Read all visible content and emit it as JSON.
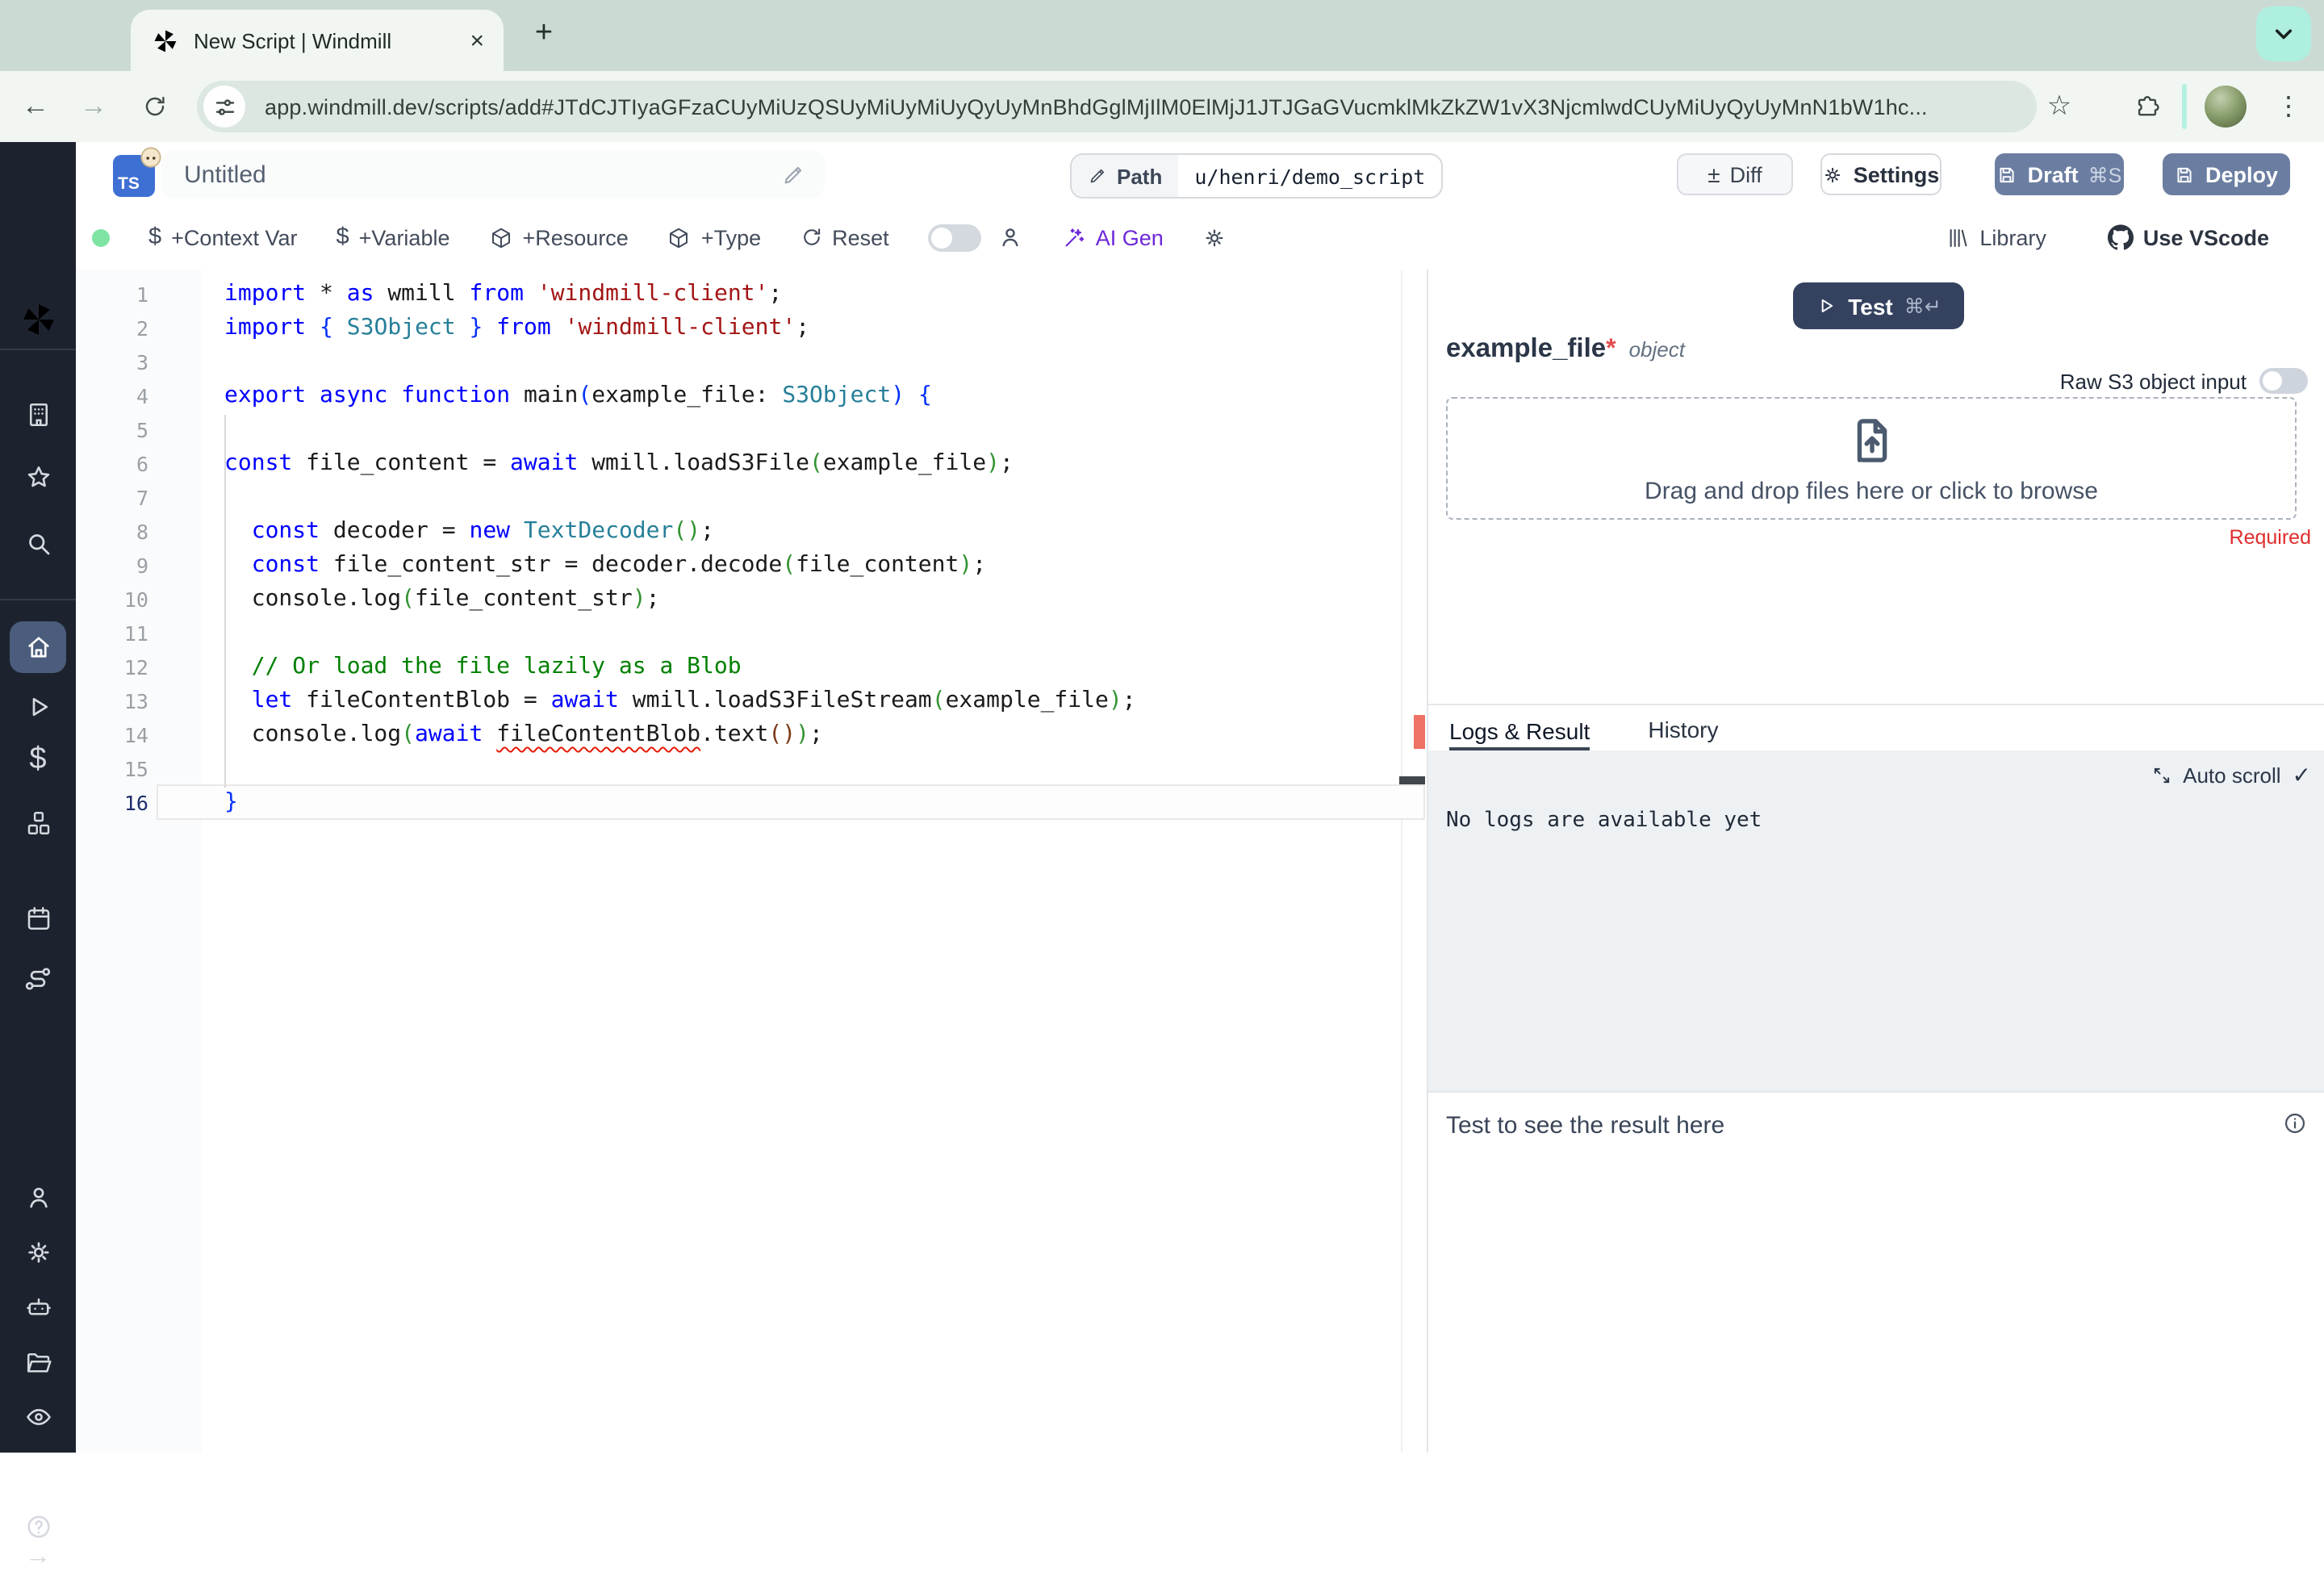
{
  "browser": {
    "tab_title": "New Script | Windmill",
    "url": "app.windmill.dev/scripts/add#JTdCJTIyaGFzaCUyMiUzQSUyMiUyMiUyQyUyMnBhdGglMjIlM0ElMjJ1JTJGaGVucmklMkZkZW1vX3NjcmlwdCUyMiUyQyUyMnN1bW1hc...",
    "glyphs": {
      "close": "×",
      "new_tab": "+",
      "back": "←",
      "forward": "→",
      "star": "☆",
      "menu": "⋮"
    }
  },
  "header": {
    "lang_badge": "TS",
    "title": "Untitled",
    "path_label": "Path",
    "path_value": "u/henri/demo_script",
    "diff_glyph": "±",
    "diff_label": "Diff",
    "settings_label": "Settings",
    "draft_label": "Draft",
    "draft_shortcut": "⌘S",
    "deploy_label": "Deploy"
  },
  "toolbar": {
    "dollar_glyph": "$",
    "context_var": "+Context Var",
    "variable": "+Variable",
    "resource": "+Resource",
    "type": "+Type",
    "reset": "Reset",
    "ai_gen": "AI Gen",
    "library": "Library",
    "vscode": "Use VScode"
  },
  "editor": {
    "active_line": 16,
    "lines": [
      {
        "n": 1,
        "t": [
          [
            "k",
            "import"
          ],
          [
            "p",
            " * "
          ],
          [
            "k",
            "as"
          ],
          [
            "p",
            " wmill "
          ],
          [
            "k",
            "from"
          ],
          [
            "p",
            " "
          ],
          [
            "s",
            "'windmill-client'"
          ],
          [
            "p",
            ";"
          ]
        ]
      },
      {
        "n": 2,
        "t": [
          [
            "k",
            "import"
          ],
          [
            "p",
            " "
          ],
          [
            "b1",
            "{"
          ],
          [
            "p",
            " "
          ],
          [
            "t",
            "S3Object"
          ],
          [
            "p",
            " "
          ],
          [
            "b1",
            "}"
          ],
          [
            "p",
            " "
          ],
          [
            "k",
            "from"
          ],
          [
            "p",
            " "
          ],
          [
            "s",
            "'windmill-client'"
          ],
          [
            "p",
            ";"
          ]
        ]
      },
      {
        "n": 3,
        "t": []
      },
      {
        "n": 4,
        "t": [
          [
            "k",
            "export"
          ],
          [
            "p",
            " "
          ],
          [
            "k",
            "async"
          ],
          [
            "p",
            " "
          ],
          [
            "k",
            "function"
          ],
          [
            "p",
            " main"
          ],
          [
            "b1",
            "("
          ],
          [
            "p",
            "example_file: "
          ],
          [
            "t",
            "S3Object"
          ],
          [
            "b1",
            ")"
          ],
          [
            "p",
            " "
          ],
          [
            "b1",
            "{"
          ]
        ]
      },
      {
        "n": 5,
        "t": []
      },
      {
        "n": 6,
        "t": [
          [
            "k",
            "const"
          ],
          [
            "p",
            " file_content = "
          ],
          [
            "k",
            "await"
          ],
          [
            "p",
            " wmill.loadS3File"
          ],
          [
            "b2",
            "("
          ],
          [
            "p",
            "example_file"
          ],
          [
            "b2",
            ")"
          ],
          [
            "p",
            ";"
          ]
        ]
      },
      {
        "n": 7,
        "t": []
      },
      {
        "n": 8,
        "t": [
          [
            "p",
            "  "
          ],
          [
            "k",
            "const"
          ],
          [
            "p",
            " decoder = "
          ],
          [
            "k",
            "new"
          ],
          [
            "p",
            " "
          ],
          [
            "t",
            "TextDecoder"
          ],
          [
            "b2",
            "()"
          ],
          [
            "p",
            ";"
          ]
        ]
      },
      {
        "n": 9,
        "t": [
          [
            "p",
            "  "
          ],
          [
            "k",
            "const"
          ],
          [
            "p",
            " file_content_str = decoder.decode"
          ],
          [
            "b2",
            "("
          ],
          [
            "p",
            "file_content"
          ],
          [
            "b2",
            ")"
          ],
          [
            "p",
            ";"
          ]
        ]
      },
      {
        "n": 10,
        "t": [
          [
            "p",
            "  console.log"
          ],
          [
            "b2",
            "("
          ],
          [
            "p",
            "file_content_str"
          ],
          [
            "b2",
            ")"
          ],
          [
            "p",
            ";"
          ]
        ]
      },
      {
        "n": 11,
        "t": []
      },
      {
        "n": 12,
        "t": [
          [
            "c",
            "  // Or load the file lazily as a Blob"
          ]
        ]
      },
      {
        "n": 13,
        "t": [
          [
            "p",
            "  "
          ],
          [
            "k",
            "let"
          ],
          [
            "p",
            " fileContentBlob = "
          ],
          [
            "k",
            "await"
          ],
          [
            "p",
            " wmill.loadS3FileStream"
          ],
          [
            "b2",
            "("
          ],
          [
            "p",
            "example_file"
          ],
          [
            "b2",
            ")"
          ],
          [
            "p",
            ";"
          ]
        ]
      },
      {
        "n": 14,
        "t": [
          [
            "p",
            "  console.log"
          ],
          [
            "b2",
            "("
          ],
          [
            "k",
            "await"
          ],
          [
            "p",
            " "
          ],
          [
            "e",
            "fileContentBlob"
          ],
          [
            "p",
            ".text"
          ],
          [
            "b3",
            "()"
          ],
          [
            "b2",
            ")"
          ],
          [
            "p",
            ";"
          ]
        ]
      },
      {
        "n": 15,
        "t": []
      },
      {
        "n": 16,
        "t": [
          [
            "b1",
            "}"
          ]
        ]
      }
    ]
  },
  "runform": {
    "test_label": "Test",
    "test_shortcut": "⌘↵",
    "arg_name": "example_file",
    "required_star": "*",
    "arg_type": "object",
    "raw_label": "Raw S3 object input",
    "dropzone_label": "Drag and drop files here or click to browse",
    "required_label": "Required"
  },
  "output": {
    "tab_logs": "Logs & Result",
    "tab_history": "History",
    "autoscroll_label": "Auto scroll",
    "check_glyph": "✓",
    "empty_logs": "No logs are available yet",
    "result_placeholder": "Test to see the result here"
  },
  "icons": {
    "windmill-logo": "pinwheel",
    "tune-icon": "sliders",
    "extensions-icon": "puzzle-piece",
    "workspace-icon": "building",
    "favorites-icon": "star",
    "search-icon": "magnifier",
    "home-icon": "house",
    "runs-icon": "play",
    "variables-icon": "dollar",
    "resources-icon": "cubes",
    "schedules-icon": "calendar",
    "flows-icon": "route",
    "user-icon": "person",
    "settings-icon": "gear",
    "workers-icon": "robot",
    "folders-icon": "folder",
    "audit-icon": "eye",
    "help-icon": "question-circle",
    "upload-icon": "file-arrow-up",
    "save-icon": "floppy"
  },
  "colors": {
    "chrome_strip": "#cbdbd4",
    "mint_accent": "#aeefdf",
    "slate_button": "#6b7ea1",
    "test_button": "#35425f",
    "sidebar_bg": "#1d232e",
    "required_red": "#e02d2d",
    "error_marker": "#ee7365",
    "ai_violet": "#6d28d9"
  }
}
